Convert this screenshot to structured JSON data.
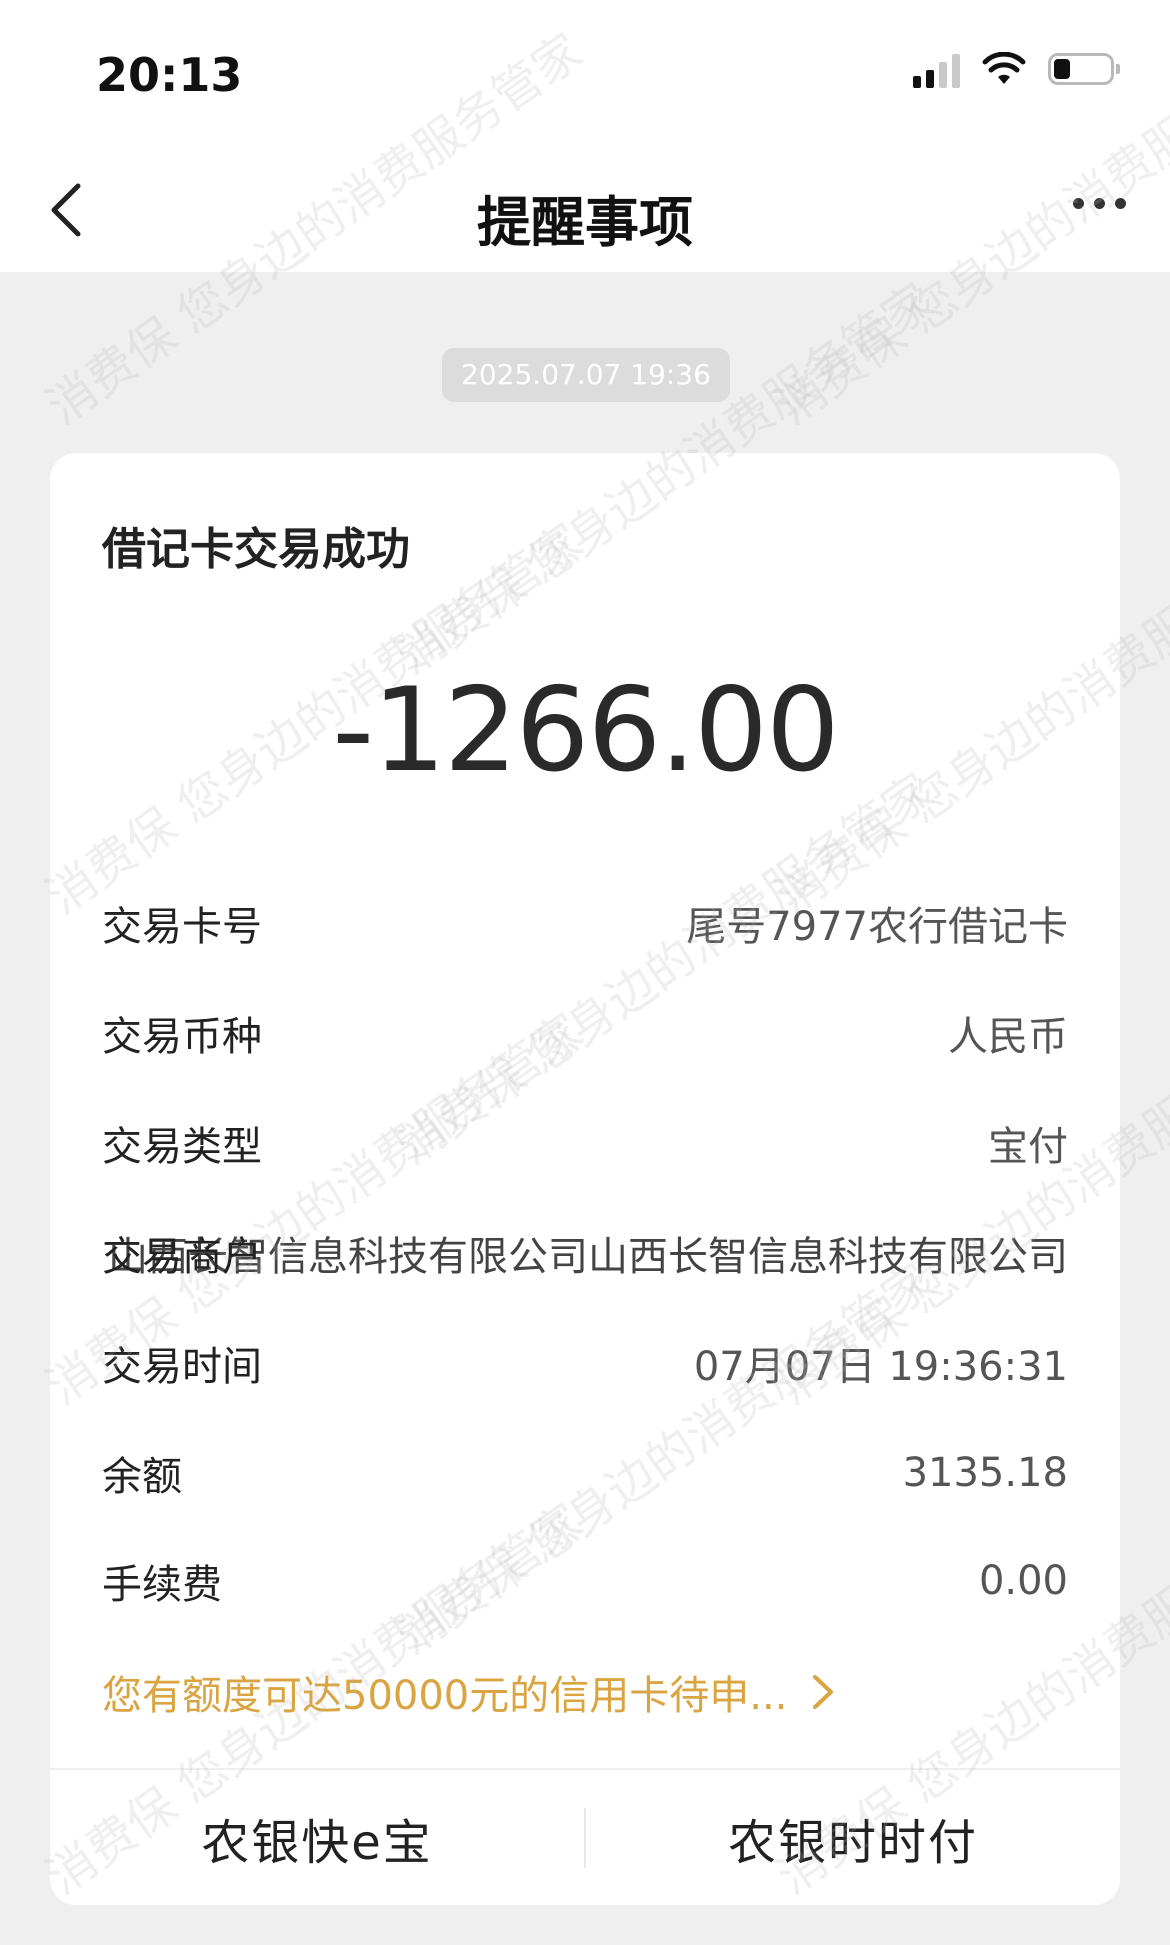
{
  "status_bar": {
    "time": "20:13",
    "battery_level": 0.3
  },
  "nav": {
    "title": "提醒事项"
  },
  "message": {
    "timestamp": "2025.07.07 19:36",
    "title": "借记卡交易成功",
    "amount": "-1266.00",
    "rows": [
      {
        "label": "交易卡号",
        "value": "尾号7977农行借记卡"
      },
      {
        "label": "交易币种",
        "value": "人民币"
      },
      {
        "label": "交易类型",
        "value": "宝付"
      },
      {
        "label": "交易商户",
        "value": "山西长智信息科技有限公司山西长智信息科技有限公司"
      },
      {
        "label": "交易时间",
        "value": "07月07日 19:36:31"
      },
      {
        "label": "余额",
        "value": "3135.18"
      },
      {
        "label": "手续费",
        "value": "0.00"
      }
    ],
    "promo": "您有额度可达50000元的信用卡待申..."
  },
  "footer": {
    "left": "农银快e宝",
    "right": "农银时时付"
  },
  "watermark": "消费保 您身边的消费服务管家",
  "colors": {
    "accent": "#d9a441",
    "background": "#efefef",
    "card": "#ffffff"
  }
}
